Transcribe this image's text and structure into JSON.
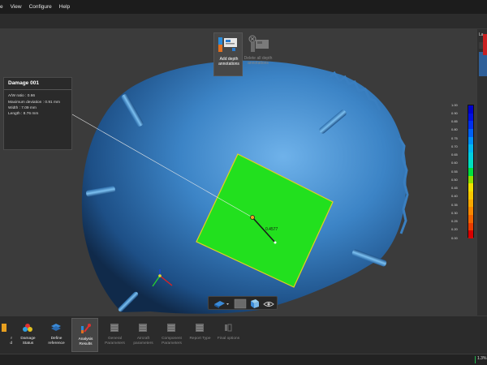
{
  "menu": {
    "items": [
      "e",
      "View",
      "Configure",
      "Help"
    ]
  },
  "top_actions": {
    "add_label": "Add depth annotations",
    "delete_label": "Delete all depth annotations"
  },
  "info": {
    "title": "Damage 001",
    "rows": [
      "A/W ratio : 0.66",
      "Maximum deviation : 0.91 mm",
      "Width : 7.09 mm",
      "Length : 8.76 mm"
    ]
  },
  "annotation": {
    "depth_label": "0.4577"
  },
  "scale": {
    "ticks": [
      "1.00",
      "0.90",
      "0.85",
      "0.80",
      "0.75",
      "0.70",
      "0.65",
      "0.60",
      "0.55",
      "0.50",
      "0.45",
      "0.40",
      "0.35",
      "0.30",
      "0.25",
      "0.20",
      "0.00"
    ],
    "colors": [
      "#0000cc",
      "#0010e0",
      "#0030ee",
      "#0060f4",
      "#0090f8",
      "#00b8f0",
      "#00d0e0",
      "#00e0c0",
      "#00e040",
      "#90e000",
      "#f0e000",
      "#f8c800",
      "#f8a800",
      "#f88800",
      "#f06400",
      "#e83c00",
      "#d80000"
    ]
  },
  "right_tab": {
    "label": "La"
  },
  "bottom_actions": [
    {
      "label": "r\nd",
      "state": "lit"
    },
    {
      "label": "Damage Status",
      "state": "lit"
    },
    {
      "label": "Define reference",
      "state": "lit"
    },
    {
      "label": "Analysis Results",
      "state": "active"
    },
    {
      "label": "General Parameters",
      "state": "dim"
    },
    {
      "label": "Aircraft parameters",
      "state": "dim"
    },
    {
      "label": "Component Parameters",
      "state": "dim"
    },
    {
      "label": "Report Type",
      "state": "dim"
    },
    {
      "label": "Final options",
      "state": "dim"
    }
  ],
  "status": {
    "zoom": "1.3%"
  },
  "colors": {
    "surface": "#3a7fc0",
    "damage": "#22e01e",
    "accent": "#1fb44c"
  }
}
